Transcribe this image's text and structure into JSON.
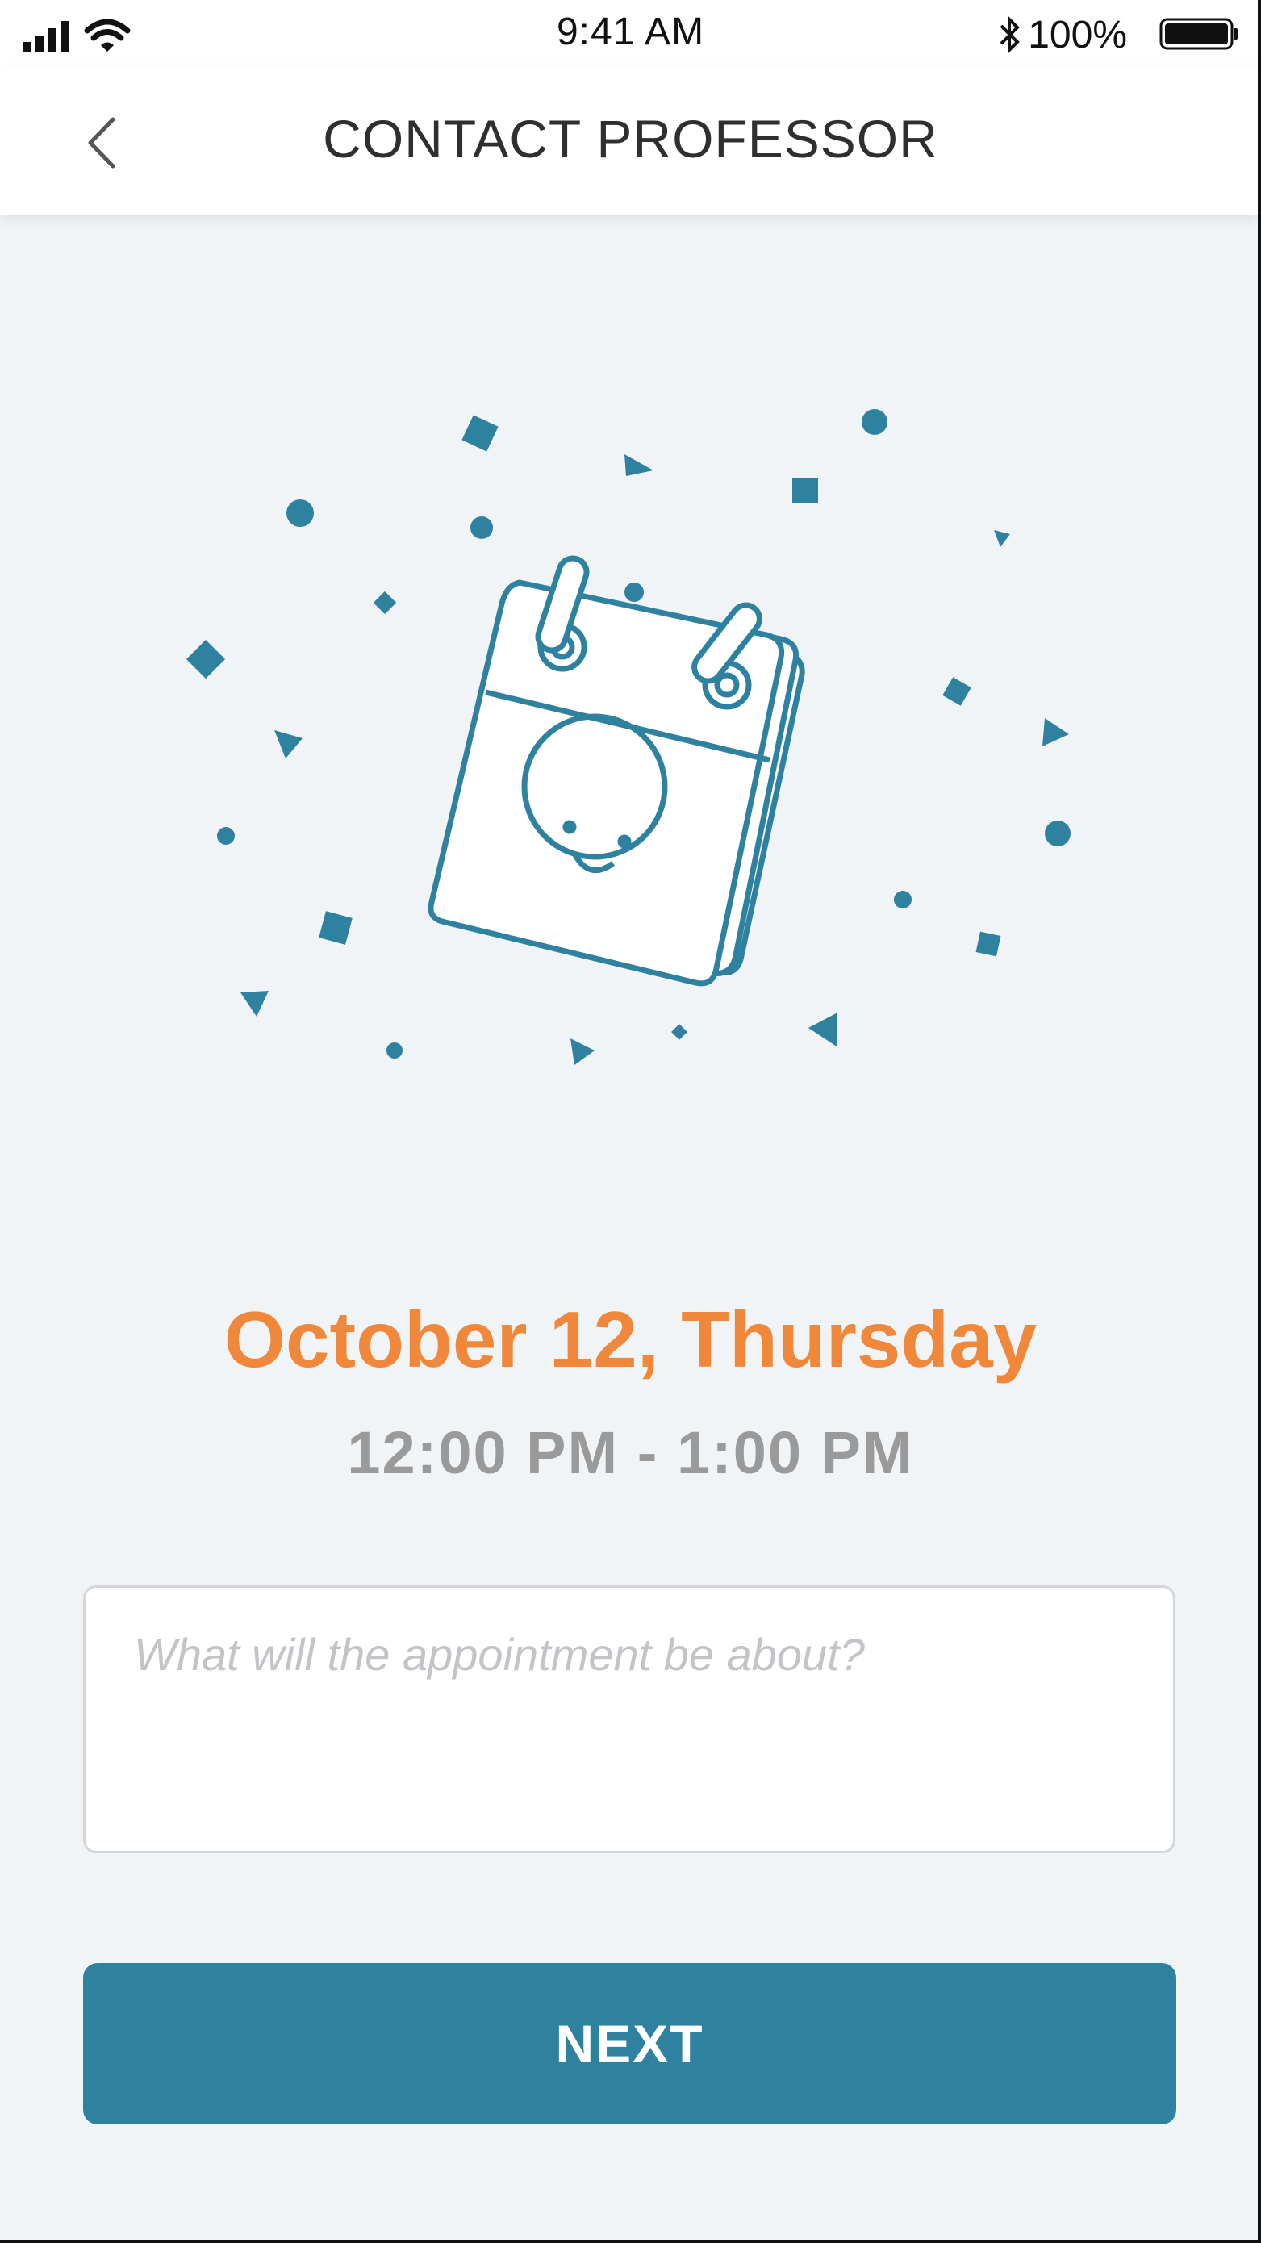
{
  "status_bar": {
    "time": "9:41 AM",
    "battery_percent": "100%",
    "icons": [
      "signal-icon",
      "wifi-icon",
      "bluetooth-icon",
      "battery-icon"
    ]
  },
  "header": {
    "title": "CONTACT PROFESSOR",
    "back_icon": "chevron-left-icon"
  },
  "appointment": {
    "date": "October 12, Thursday",
    "time_range": "12:00 PM - 1:00 PM"
  },
  "topic_input": {
    "value": "",
    "placeholder": "What will the appointment be about?"
  },
  "next_button": {
    "label": "NEXT"
  },
  "colors": {
    "accent": "#2f829f",
    "date_orange": "#f0883c",
    "time_gray": "#9a9a9a",
    "background": "#f1f4f7"
  }
}
